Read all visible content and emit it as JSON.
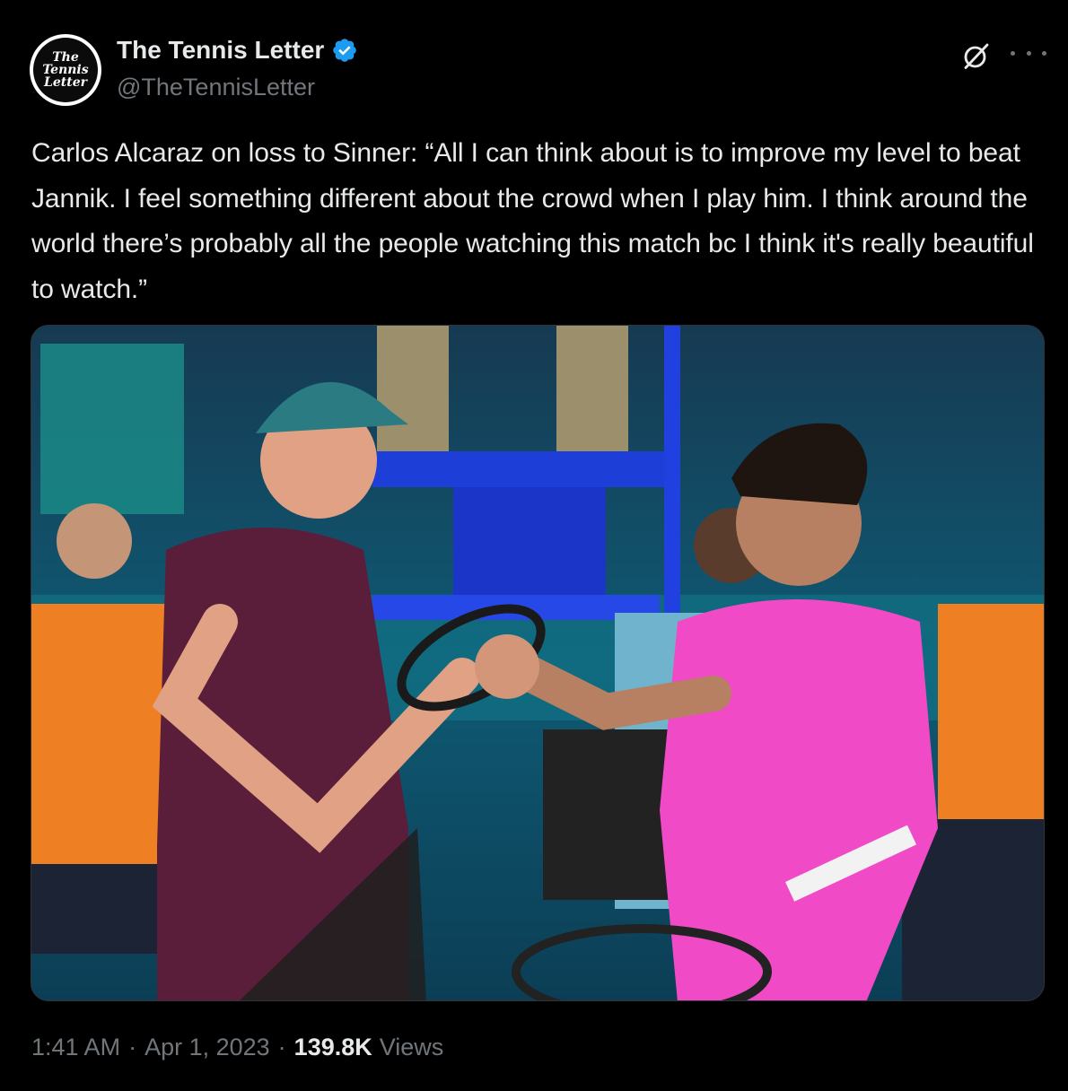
{
  "author": {
    "display_name": "The Tennis Letter",
    "handle": "@TheTennisLetter",
    "verified": true,
    "avatar_text": [
      "The",
      "Tennis",
      "Letter"
    ],
    "verified_color": "#1d9bf0"
  },
  "tweet": {
    "text": "Carlos Alcaraz on loss to Sinner: “All I can think about is to improve my level to beat Jannik. I feel something different about the crowd when I play him. I think around the world there’s probably all the people watching this match bc I think it's really beautiful to watch.”",
    "time": "1:41 AM",
    "date": "Apr 1, 2023",
    "separator": "·",
    "views_count": "139.8K",
    "views_label": "Views"
  },
  "media": {
    "icon": "photo"
  },
  "icons": {
    "grok": "grok-icon",
    "more": "more-icon",
    "verified": "verified-badge-icon"
  },
  "colors": {
    "background": "#000000",
    "primary_text": "#e7e9ea",
    "secondary_text": "#71767b",
    "verified": "#1d9bf0"
  }
}
